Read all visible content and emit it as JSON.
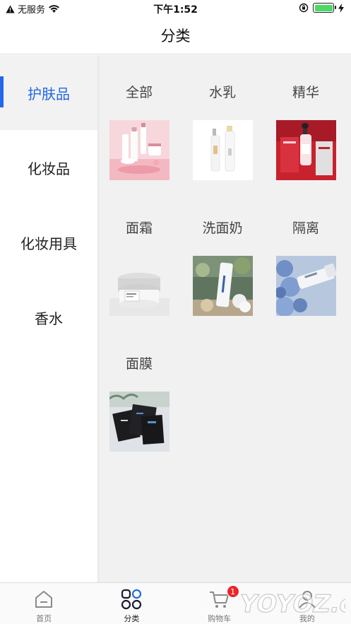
{
  "status_bar": {
    "carrier": "无服务",
    "time": "下午1:52",
    "battery_color": "#4cd964"
  },
  "nav": {
    "title": "分类"
  },
  "sidebar": {
    "accent": "#2268e8",
    "items": [
      {
        "label": "护肤品",
        "active": true
      },
      {
        "label": "化妆品",
        "active": false
      },
      {
        "label": "化妆用具",
        "active": false
      },
      {
        "label": "香水",
        "active": false
      }
    ]
  },
  "categories": [
    {
      "label": "全部",
      "image": "skincare-set-pink"
    },
    {
      "label": "水乳",
      "image": "toner-lotion-bottles"
    },
    {
      "label": "精华",
      "image": "serum-red-box"
    },
    {
      "label": "面霜",
      "image": "cream-jar"
    },
    {
      "label": "洗面奶",
      "image": "cleanser-tube"
    },
    {
      "label": "隔离",
      "image": "primer-tube-blue-flowers"
    },
    {
      "label": "面膜",
      "image": "face-mask-packets"
    }
  ],
  "tab_bar": {
    "tabs": [
      {
        "label": "首页",
        "icon": "home-icon",
        "active": false
      },
      {
        "label": "分类",
        "icon": "category-icon",
        "active": true
      },
      {
        "label": "购物车",
        "icon": "cart-icon",
        "active": false,
        "badge": "1"
      },
      {
        "label": "我的",
        "icon": "profile-icon",
        "active": false
      }
    ]
  },
  "watermark": "YOYOZ.com"
}
